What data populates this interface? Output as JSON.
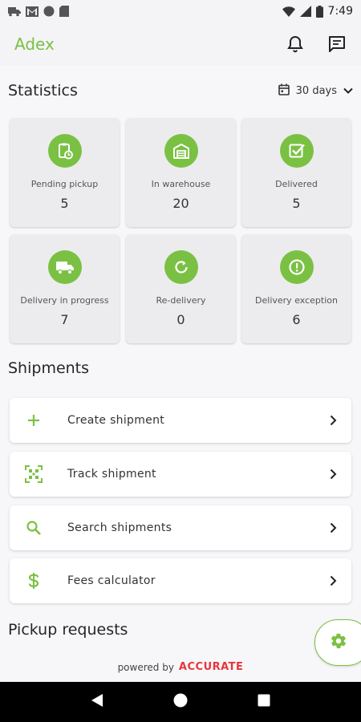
{
  "status_bar": {
    "time": "7:49"
  },
  "app": {
    "title": "Adex"
  },
  "statistics": {
    "title": "Statistics",
    "range_label": "30 days",
    "cards": [
      {
        "label": "Pending pickup",
        "value": "5",
        "icon": "clipboard-clock-icon"
      },
      {
        "label": "In warehouse",
        "value": "20",
        "icon": "warehouse-icon"
      },
      {
        "label": "Delivered",
        "value": "5",
        "icon": "checkbox-icon"
      },
      {
        "label": "Delivery in progress",
        "value": "7",
        "icon": "truck-icon"
      },
      {
        "label": "Re-delivery",
        "value": "0",
        "icon": "refresh-icon"
      },
      {
        "label": "Delivery exception",
        "value": "6",
        "icon": "exclamation-icon"
      }
    ]
  },
  "shipments": {
    "title": "Shipments",
    "items": [
      {
        "label": "Create shipment",
        "icon": "plus-icon"
      },
      {
        "label": "Track shipment",
        "icon": "qr-scan-icon"
      },
      {
        "label": "Search shipments",
        "icon": "search-icon"
      },
      {
        "label": "Fees calculator",
        "icon": "dollar-icon"
      }
    ]
  },
  "pickup": {
    "title": "Pickup requests"
  },
  "footer": {
    "powered_by": "powered by",
    "brand": "ACCURATE"
  },
  "colors": {
    "accent": "#7ac143",
    "brand_red": "#e8353a",
    "card_bg": "#ececee"
  }
}
